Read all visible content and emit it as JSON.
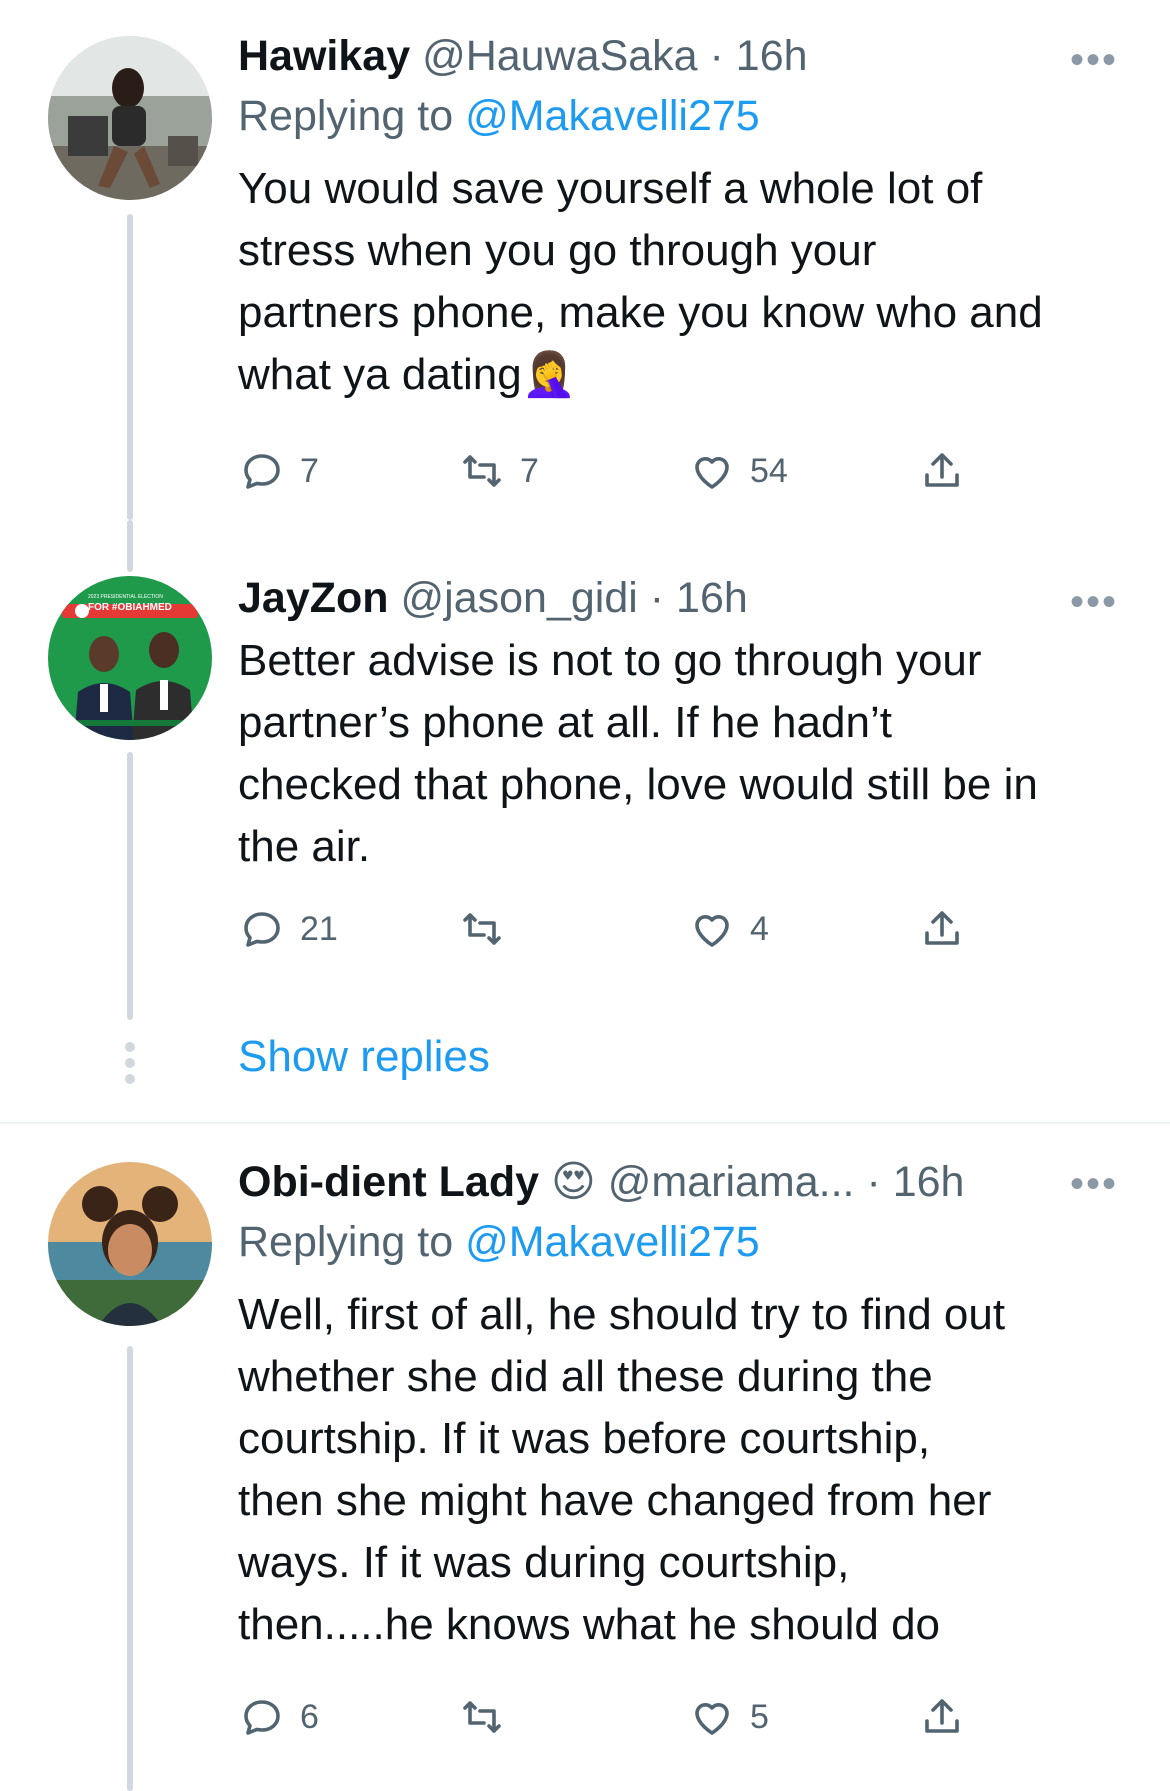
{
  "tweets": [
    {
      "name": "Hawikay",
      "handle": "@HauwaSaka",
      "time": "· 16h",
      "replying_prefix": "Replying to ",
      "replying_to": "@Makavelli275",
      "text": "You would save yourself a whole lot of\nstress when you go through your\npartners phone, make you know who and\nwhat ya dating",
      "emoji": "🤦‍♀️",
      "replies": "7",
      "retweets": "7",
      "likes": "54"
    },
    {
      "name": "JayZon",
      "handle": "@jason_gidi",
      "time": "· 16h",
      "text": "Better advise is not to go through your\npartner’s phone at all. If he hadn’t\nchecked that phone, love would still be in\nthe air.",
      "avatar_banner": "FOR #OBIAHMED",
      "avatar_small": "2023 PRESIDENTIAL ELECTION",
      "replies": "21",
      "retweets": "",
      "likes": "4"
    },
    {
      "name": "Obi-dient Lady",
      "name_emoji": "😍",
      "handle": "@mariama...",
      "time": "· 16h",
      "replying_prefix": "Replying to ",
      "replying_to": "@Makavelli275",
      "text": "Well, first of all, he should try to find out\nwhether she did all these during the\ncourtship. If it was before courtship,\nthen she might have changed from her\nways. If it was during courtship,\nthen.....he knows what he should do",
      "replies": "6",
      "retweets": "",
      "likes": "5"
    }
  ],
  "show_replies": "Show replies",
  "more_glyph": "•••",
  "colors": {
    "link": "#1d9bf0",
    "muted": "#536471",
    "thread": "#cfd9de"
  },
  "icons": [
    "reply-icon",
    "retweet-icon",
    "like-icon",
    "share-icon",
    "more-icon"
  ]
}
